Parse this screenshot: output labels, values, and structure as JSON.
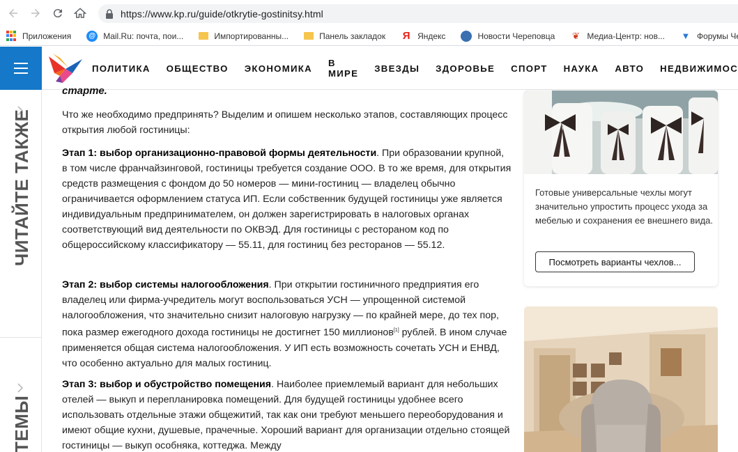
{
  "browser": {
    "url": "https://www.kp.ru/guide/otkrytie-gostinitsy.html",
    "bookmarks": [
      {
        "label": "Приложения",
        "icon": "apps-icon"
      },
      {
        "label": "Mail.Ru: почта, пои...",
        "icon": "mailru-icon"
      },
      {
        "label": "Импортированны...",
        "icon": "folder-icon"
      },
      {
        "label": "Панель закладок",
        "icon": "folder-icon"
      },
      {
        "label": "Яндекс",
        "icon": "yandex-icon"
      },
      {
        "label": "Новости Череповца",
        "icon": "news-icon"
      },
      {
        "label": "Медиа-Центр: нов...",
        "icon": "media-icon"
      },
      {
        "label": "Форумы Череп",
        "icon": "forum-icon"
      }
    ]
  },
  "nav": {
    "items": [
      "ПОЛИТИКА",
      "ОБЩЕСТВО",
      "ЭКОНОМИКА",
      "В МИРЕ",
      "ЗВЕЗДЫ",
      "ЗДОРОВЬЕ",
      "СПОРТ",
      "НАУКА",
      "АВТО",
      "НЕДВИЖИМОСТЬ"
    ]
  },
  "rail": {
    "read_also": "ЧИТАЙТЕ ТАКЖЕ",
    "topics": "ТЕМЫ"
  },
  "article": {
    "cut_text": "старте.",
    "intro": "Что же необходимо предпринять? Выделим и опишем несколько этапов, составляющих процесс открытия любой гостиницы:",
    "step1_title": "Этап 1: выбор организационно-правовой формы деятельности",
    "step1_text": ". При образовании крупной, в том числе франчайзинговой, гостиницы требуется создание ООО. В то же время, для открытия средств размещения с фондом до 50 номеров — мини-гостиниц — владелец обычно ограничивается оформлением статуса ИП. Если собственник будущей гостиницы уже является индивидуальным предпринимателем, он должен зарегистрировать в налоговых органах соответствующий вид деятельности по ОКВЭД. Для гостиницы с рестораном код по общероссийскому классификатору — 55.11, для гостиниц без ресторанов — 55.12.",
    "step2_title": "Этап 2: выбор системы налогообложения",
    "step2_text_a": ". При открытии гостиничного предприятия его владелец или фирма-учредитель могут воспользоваться УСН — упрощенной системой налогообложения, что значительно снизит налоговую нагрузку — по крайней мере, до тех пор, пока размер ежегодного дохода гостиницы не достигнет 150 миллионов",
    "step2_sup": "[1]",
    "step2_text_b": " рублей. В ином случае применяется общая система налогообложения. У ИП есть возможность сочетать УСН и ЕНВД, что особенно актуально для малых гостиниц.",
    "step3_title": "Этап 3: выбор и обустройство помещения",
    "step3_text": ". Наиболее приемлемый вариант для небольших отелей — выкуп и перепланировка помещений. Для будущей гостиницы удобнее всего использовать отдельные этажи общежитий, так как они требуют меньшего переоборудования и имеют общие кухни, душевые, прачечные. Хороший вариант для организации отдельно стоящей гостиницы — выкуп особняка, коттеджа. Между"
  },
  "ad": {
    "caption": "Готовые универсальные чехлы могут значительно упростить процесс ухода за мебелью и сохранения ее внешнего вида.",
    "button": "Посмотреть варианты чехлов..."
  },
  "colors": {
    "brand_blue": "#1578c8"
  }
}
